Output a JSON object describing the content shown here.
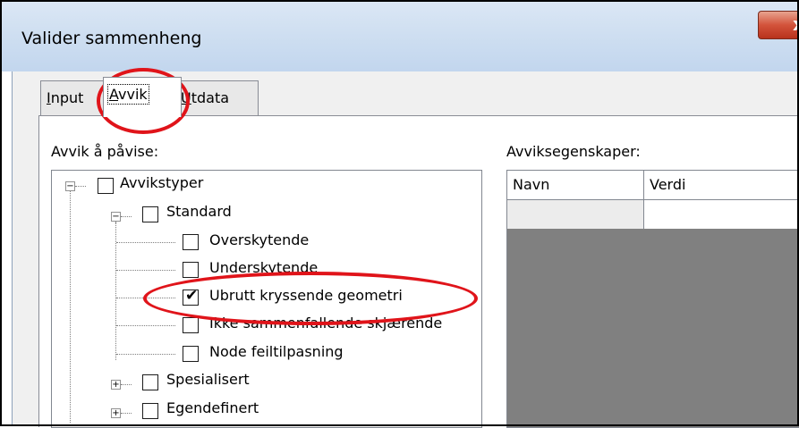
{
  "window": {
    "title": "Valider sammenheng",
    "close_glyph": "x"
  },
  "tabs": [
    {
      "label_pre": "",
      "label_ul": "I",
      "label_post": "nput",
      "display": "Input"
    },
    {
      "label_pre": "",
      "label_ul": "A",
      "label_post": "vvik",
      "display": "Avvik"
    },
    {
      "label_pre": "",
      "label_ul": "U",
      "label_post": "tdata",
      "display": "Utdata"
    }
  ],
  "left": {
    "label": "Avvik å påvise:",
    "tree": {
      "root": {
        "label": "Avvikstyper",
        "checked": false,
        "expanded": true
      },
      "standard": {
        "label": "Standard",
        "checked": false,
        "expanded": true
      },
      "items": [
        {
          "label": "Overskytende",
          "checked": false
        },
        {
          "label": "Underskytende",
          "checked": false
        },
        {
          "label": "Ubrutt kryssende geometri",
          "checked": true
        },
        {
          "label": "Ikke sammenfallende skjærende",
          "checked": false
        },
        {
          "label": "Node feiltilpasning",
          "checked": false
        }
      ],
      "spesialisert": {
        "label": "Spesialisert",
        "checked": false,
        "expanded": false
      },
      "egendefinert": {
        "label": "Egendefinert",
        "checked": false,
        "expanded": false
      }
    }
  },
  "right": {
    "label": "Avviksegenskaper:",
    "columns": [
      "Navn",
      "Verdi"
    ]
  },
  "colors": {
    "highlight_ellipse": "#e0141a",
    "grid_background": "#808080"
  }
}
